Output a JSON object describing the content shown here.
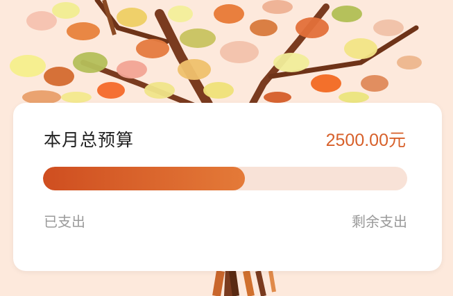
{
  "colors": {
    "page_bg": "#fde9dc",
    "accent": "#d7602a",
    "progress_track": "#f8e2d7",
    "progress_fill_start": "#cf4e20",
    "progress_fill_end": "#e47a38"
  },
  "budget": {
    "title": "本月总预算",
    "amount": "2500.00元",
    "spent_label": "已支出",
    "remaining_label": "剩余支出",
    "progress_fraction": 0.555
  }
}
